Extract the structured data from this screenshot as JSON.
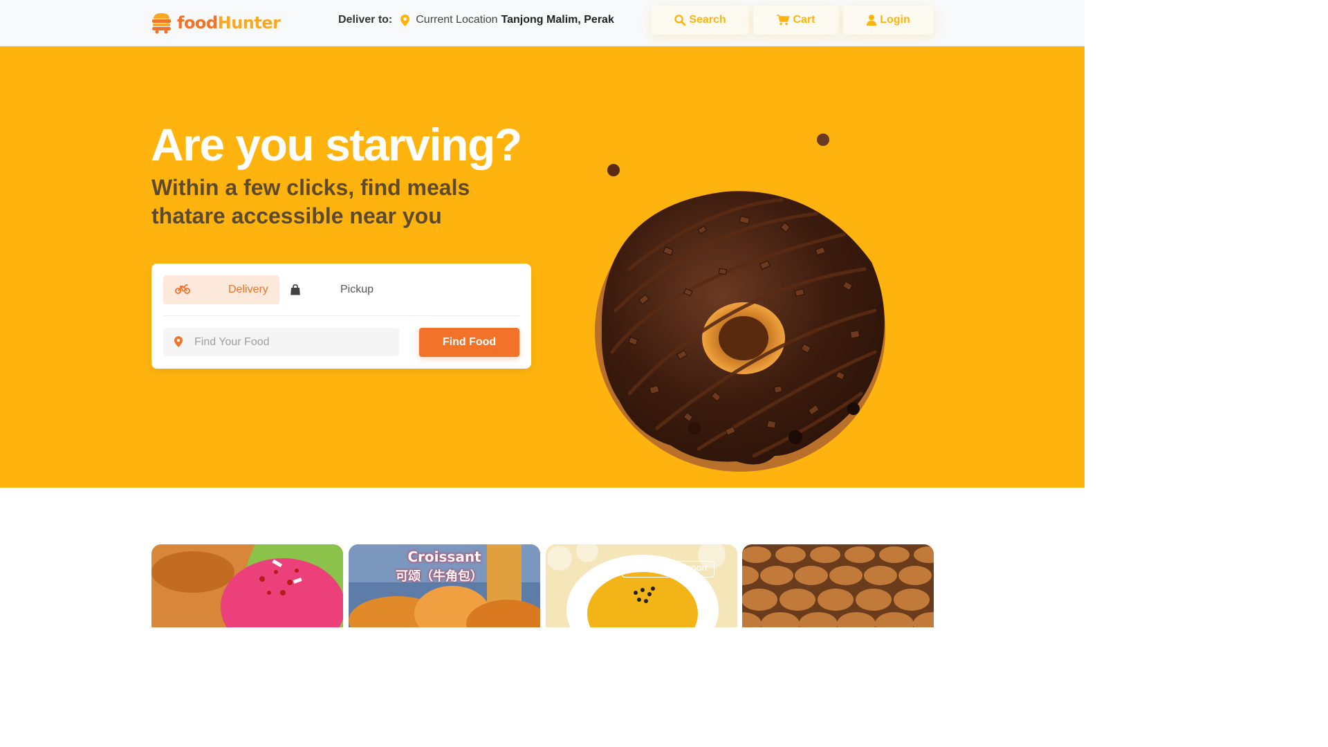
{
  "header": {
    "logo": {
      "prefix": "food",
      "suffix": "Hunter"
    },
    "deliver_label": "Deliver to:",
    "location_label": "Current Location",
    "location_city": "Tanjong Malim, Perak",
    "nav": {
      "search": "Search",
      "cart": "Cart",
      "login": "Login"
    }
  },
  "hero": {
    "title": "Are you starving?",
    "subtitle": "Within a few clicks, find meals thatare accessible near you",
    "tabs": {
      "delivery": "Delivery",
      "pickup": "Pickup"
    },
    "search": {
      "placeholder": "Find Your Food",
      "value": ""
    },
    "find_button": "Find Food"
  },
  "cards": {
    "croissant_title": "Croissant",
    "croissant_subtitle": "可颂（牛角包）",
    "kedai_tag": "KEDAI ROTI SINGGIT"
  },
  "colors": {
    "accent": "#f17228",
    "hero_bg": "#ffb30e",
    "nav_text": "#ffb30e"
  },
  "icons": [
    "burger-logo-icon",
    "map-pin-icon",
    "search-icon",
    "cart-icon",
    "user-icon",
    "motorbike-icon",
    "bag-icon"
  ]
}
